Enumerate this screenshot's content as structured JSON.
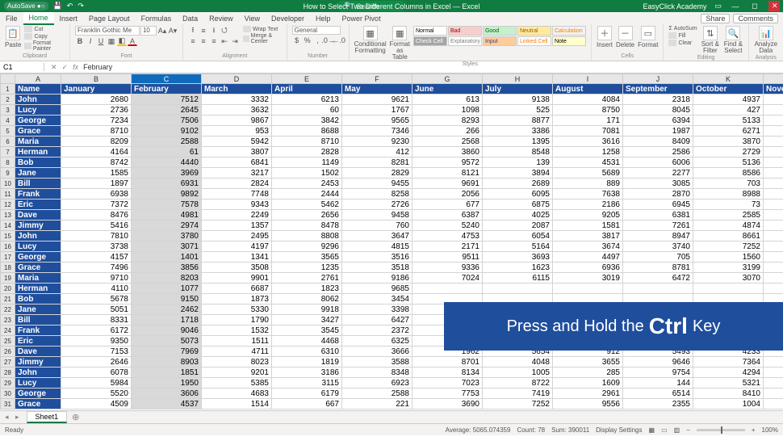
{
  "title": {
    "autosave": "AutoSave ●○",
    "doc": "How to Select Two Different Columns in Excel — Excel",
    "search_placeholder": "Search",
    "brand": "EasyClick Academy"
  },
  "menu": {
    "items": [
      "File",
      "Home",
      "Insert",
      "Page Layout",
      "Formulas",
      "Data",
      "Review",
      "View",
      "Developer",
      "Help",
      "Power Pivot"
    ],
    "active": "Home",
    "share": "Share",
    "comments": "Comments"
  },
  "ribbon": {
    "clipboard": {
      "label": "Clipboard",
      "paste": "Paste",
      "cut": "Cut",
      "copy": "Copy",
      "fmt": "Format Painter"
    },
    "font": {
      "label": "Font",
      "name": "Franklin Gothic Me",
      "size": "10"
    },
    "alignment": {
      "label": "Alignment",
      "wrap": "Wrap Text",
      "merge": "Merge & Center"
    },
    "number": {
      "label": "Number",
      "format": "General"
    },
    "styles": {
      "label": "Styles",
      "condfmt": "Conditional Formatting",
      "asTable": "Format as Table",
      "cellStyles": "Cell Styles",
      "grid": [
        [
          {
            "t": "Normal",
            "bg": "#fff",
            "c": "#000"
          },
          {
            "t": "Bad",
            "bg": "#f8cecc",
            "c": "#9c0006"
          },
          {
            "t": "Good",
            "bg": "#c6efce",
            "c": "#006100"
          },
          {
            "t": "Neutral",
            "bg": "#ffeb9c",
            "c": "#9c5700"
          },
          {
            "t": "Calculation",
            "bg": "#f2f2f2",
            "c": "#fa7d00"
          }
        ],
        [
          {
            "t": "Check Cell",
            "bg": "#a5a5a5",
            "c": "#fff"
          },
          {
            "t": "Explanatory",
            "bg": "#fff",
            "c": "#7f7f7f"
          },
          {
            "t": "Input",
            "bg": "#ffcc99",
            "c": "#3f3f76"
          },
          {
            "t": "Linked Cell",
            "bg": "#fff",
            "c": "#fa7d00"
          },
          {
            "t": "Note",
            "bg": "#ffffcc",
            "c": "#000"
          }
        ]
      ]
    },
    "cells": {
      "label": "Cells",
      "insert": "Insert",
      "delete": "Delete",
      "format": "Format"
    },
    "editing": {
      "label": "Editing",
      "autosum": "AutoSum",
      "fill": "Fill",
      "clear": "Clear",
      "sort": "Sort & Filter",
      "find": "Find & Select"
    },
    "analysis": {
      "label": "Analysis",
      "analyze": "Analyze Data"
    }
  },
  "formulabar": {
    "namebox": "C1",
    "fx": "fx",
    "value": "February"
  },
  "columns": [
    "A",
    "B",
    "C",
    "D",
    "E",
    "F",
    "G",
    "H",
    "I",
    "J",
    "K",
    ""
  ],
  "selected_col_idx": 2,
  "headers": [
    "Name",
    "January",
    "February",
    "March",
    "April",
    "May",
    "June",
    "July",
    "August",
    "September",
    "October",
    "Novem"
  ],
  "rows": [
    {
      "n": "John",
      "v": [
        2680,
        7512,
        3332,
        6213,
        9621,
        613,
        9138,
        4084,
        2318,
        4937
      ]
    },
    {
      "n": "Lucy",
      "v": [
        2736,
        2645,
        3632,
        60,
        1767,
        1098,
        525,
        8750,
        8045,
        427
      ]
    },
    {
      "n": "George",
      "v": [
        7234,
        7506,
        9867,
        3842,
        9565,
        8293,
        8877,
        171,
        6394,
        5133
      ]
    },
    {
      "n": "Grace",
      "v": [
        8710,
        9102,
        953,
        8688,
        7346,
        266,
        3386,
        7081,
        1987,
        6271
      ]
    },
    {
      "n": "Maria",
      "v": [
        8209,
        2588,
        5942,
        8710,
        9230,
        2568,
        1395,
        3616,
        8409,
        3870
      ]
    },
    {
      "n": "Herman",
      "v": [
        4164,
        61,
        3807,
        2828,
        412,
        3860,
        8548,
        1258,
        2586,
        2729
      ]
    },
    {
      "n": "Bob",
      "v": [
        8742,
        4440,
        6841,
        1149,
        8281,
        9572,
        139,
        4531,
        6006,
        5136
      ]
    },
    {
      "n": "Jane",
      "v": [
        1585,
        3969,
        3217,
        1502,
        2829,
        8121,
        3894,
        5689,
        2277,
        8586
      ]
    },
    {
      "n": "Bill",
      "v": [
        1897,
        6931,
        2824,
        2453,
        9455,
        9691,
        2689,
        889,
        3085,
        703
      ]
    },
    {
      "n": "Frank",
      "v": [
        6938,
        9892,
        7748,
        2444,
        8258,
        2056,
        6095,
        7638,
        2870,
        8988
      ]
    },
    {
      "n": "Eric",
      "v": [
        7372,
        7578,
        9343,
        5462,
        2726,
        677,
        6875,
        2186,
        6945,
        73
      ]
    },
    {
      "n": "Dave",
      "v": [
        8476,
        4981,
        2249,
        2656,
        9458,
        6387,
        4025,
        9205,
        6381,
        2585
      ]
    },
    {
      "n": "Jimmy",
      "v": [
        5416,
        2974,
        1357,
        8478,
        760,
        5240,
        2087,
        1581,
        7261,
        4874
      ]
    },
    {
      "n": "John",
      "v": [
        7810,
        3780,
        2495,
        8808,
        3647,
        4753,
        6054,
        3817,
        8947,
        8661
      ]
    },
    {
      "n": "Lucy",
      "v": [
        3738,
        3071,
        4197,
        9296,
        4815,
        2171,
        5164,
        3674,
        3740,
        7252
      ]
    },
    {
      "n": "George",
      "v": [
        4157,
        1401,
        1341,
        3565,
        3516,
        9511,
        3693,
        4497,
        705,
        1560
      ]
    },
    {
      "n": "Grace",
      "v": [
        7496,
        3856,
        3508,
        1235,
        3518,
        9336,
        1623,
        6936,
        8781,
        3199
      ]
    },
    {
      "n": "Maria",
      "v": [
        9710,
        8203,
        9901,
        2761,
        9186,
        7024,
        6115,
        3019,
        6472,
        3070
      ]
    },
    {
      "n": "Herman",
      "v": [
        4110,
        1077,
        6687,
        1823,
        9685,
        "",
        "",
        "",
        "",
        ""
      ]
    },
    {
      "n": "Bob",
      "v": [
        5678,
        9150,
        1873,
        8062,
        3454,
        "",
        "",
        "",
        "",
        ""
      ]
    },
    {
      "n": "Jane",
      "v": [
        5051,
        2462,
        5330,
        9918,
        3398,
        "",
        "",
        "",
        "",
        ""
      ]
    },
    {
      "n": "Bill",
      "v": [
        8331,
        1718,
        1790,
        3427,
        6427,
        "",
        "",
        "",
        "",
        ""
      ]
    },
    {
      "n": "Frank",
      "v": [
        6172,
        9046,
        1532,
        3545,
        2372,
        "",
        "",
        "",
        "",
        ""
      ]
    },
    {
      "n": "Eric",
      "v": [
        9350,
        5073,
        1511,
        4468,
        6325,
        "",
        "",
        "",
        "",
        ""
      ]
    },
    {
      "n": "Dave",
      "v": [
        7153,
        7969,
        4711,
        6310,
        3666,
        1962,
        5654,
        912,
        5493,
        4233
      ]
    },
    {
      "n": "Jimmy",
      "v": [
        2646,
        8903,
        8023,
        1819,
        3588,
        8701,
        4048,
        3655,
        9646,
        7364
      ]
    },
    {
      "n": "John",
      "v": [
        6078,
        1851,
        9201,
        3186,
        8348,
        8134,
        1005,
        285,
        9754,
        4294
      ]
    },
    {
      "n": "Lucy",
      "v": [
        5984,
        1950,
        5385,
        3115,
        6923,
        7023,
        8722,
        1609,
        144,
        5321
      ]
    },
    {
      "n": "George",
      "v": [
        5520,
        3606,
        4683,
        6179,
        2588,
        7753,
        7419,
        2961,
        6514,
        8410
      ]
    },
    {
      "n": "Grace",
      "v": [
        4509,
        4537,
        1514,
        667,
        221,
        3690,
        7252,
        9556,
        2355,
        1004
      ]
    }
  ],
  "overlay": {
    "pre": "Press and Hold the",
    "key": "Ctrl",
    "post": "Key"
  },
  "sheets": {
    "active": "Sheet1"
  },
  "status": {
    "ready": "Ready",
    "avg": "Average: 5065.074359",
    "count": "Count: 78",
    "sum": "Sum: 390011",
    "display": "Display Settings",
    "zoom": "100%"
  }
}
